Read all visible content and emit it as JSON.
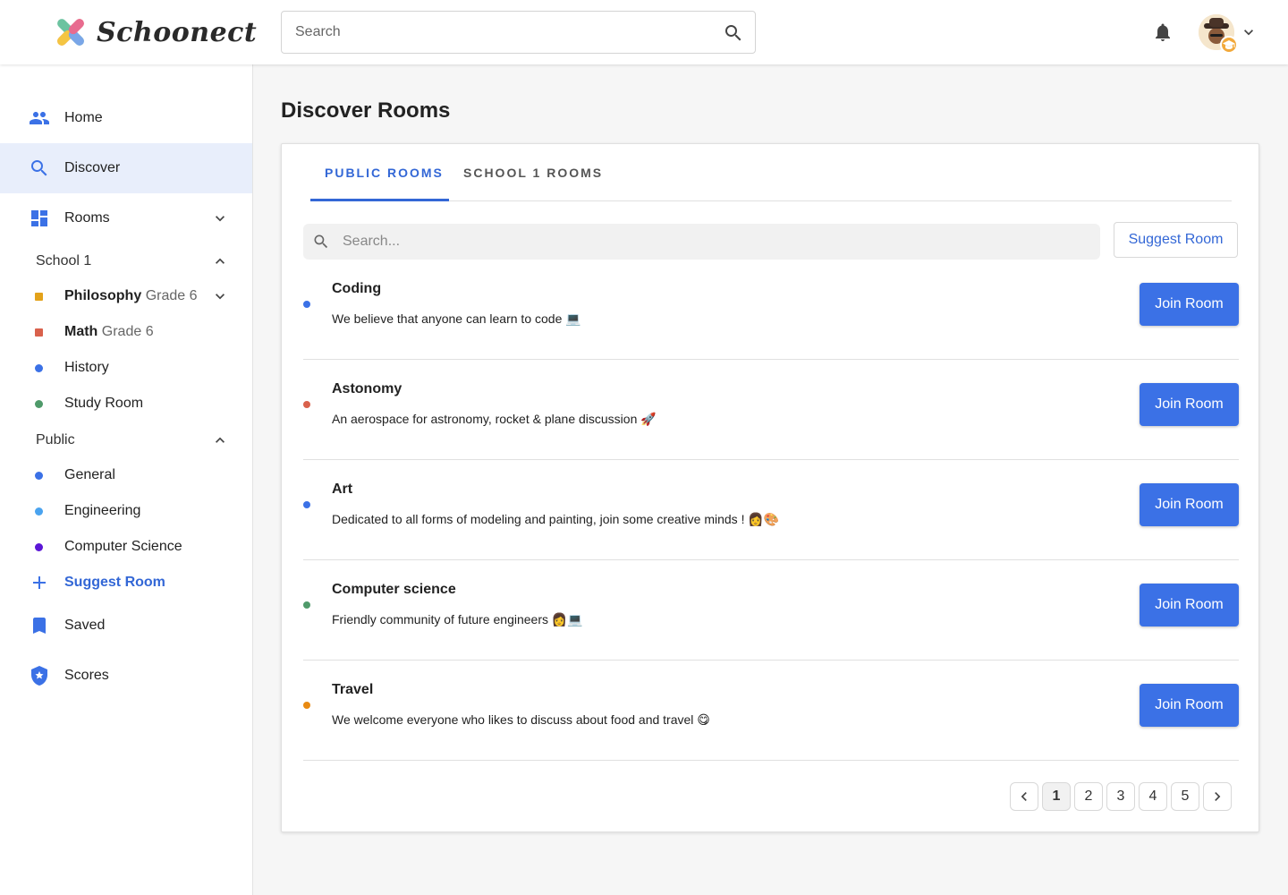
{
  "app": {
    "name": "Schoonect"
  },
  "header": {
    "search_placeholder": "Search",
    "icons": [
      "search-icon",
      "bell-icon",
      "avatar",
      "chevron-down-icon"
    ]
  },
  "sidebar": {
    "home": "Home",
    "discover": "Discover",
    "rooms": "Rooms",
    "school_group": "School 1",
    "school_rooms": [
      {
        "name": "Philosophy",
        "grade": "Grade 6",
        "color": "#e3a21a"
      },
      {
        "name": "Math",
        "grade": "Grade 6",
        "color": "#d9614c"
      },
      {
        "name": "History",
        "color": "#3b71e6"
      },
      {
        "name": "Study Room",
        "color": "#4f9a6a"
      }
    ],
    "public_group": "Public",
    "public_rooms": [
      {
        "name": "General",
        "color": "#3b71e6"
      },
      {
        "name": "Engineering",
        "color": "#4aa3ef"
      },
      {
        "name": "Computer Science",
        "color": "#5b16d6"
      }
    ],
    "suggest_room": "Suggest Room",
    "saved": "Saved",
    "scores": "Scores"
  },
  "main": {
    "title": "Discover Rooms",
    "tabs": [
      "PUBLIC ROOMS",
      "SCHOOL 1 ROOMS"
    ],
    "search_placeholder": "Search...",
    "suggest_button": "Suggest Room",
    "join_label": "Join Room",
    "rooms": [
      {
        "name": "Coding",
        "description": "We believe that anyone can learn to code 💻",
        "color": "#3b71e6"
      },
      {
        "name": "Astonomy",
        "description": "An aerospace for astronomy, rocket & plane discussion  🚀",
        "color": "#d9614c"
      },
      {
        "name": "Art",
        "description": "Dedicated to all forms of modeling and painting, join some creative minds ! 👩🎨",
        "color": "#3b71e6"
      },
      {
        "name": "Computer science",
        "description": "Friendly community of future engineers 👩💻",
        "color": "#4f9a6a"
      },
      {
        "name": "Travel",
        "description": "We welcome everyone who likes to discuss about food and travel 😋",
        "color": "#e88a12"
      }
    ],
    "pagination": {
      "pages": [
        "1",
        "2",
        "3",
        "4",
        "5"
      ],
      "current": "1"
    }
  }
}
